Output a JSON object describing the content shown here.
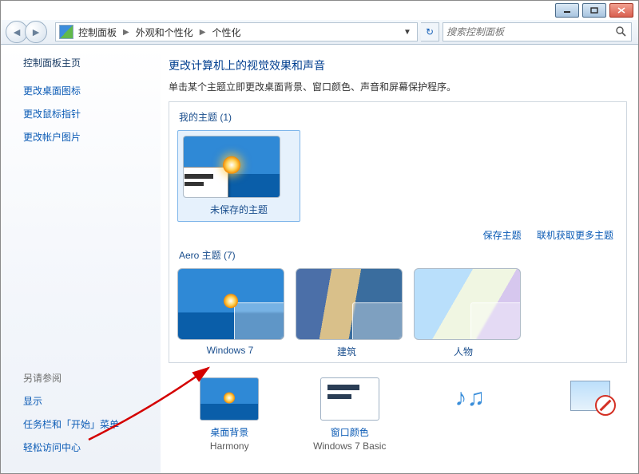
{
  "breadcrumb": {
    "root": "控制面板",
    "mid": "外观和个性化",
    "leaf": "个性化"
  },
  "search_placeholder": "搜索控制面板",
  "sidebar": {
    "home": "控制面板主页",
    "links": [
      "更改桌面图标",
      "更改鼠标指针",
      "更改帐户图片"
    ],
    "see_also_label": "另请参阅",
    "see_also": [
      "显示",
      "任务栏和「开始」菜单",
      "轻松访问中心"
    ]
  },
  "main": {
    "title": "更改计算机上的视觉效果和声音",
    "subtitle": "单击某个主题立即更改桌面背景、窗口颜色、声音和屏幕保护程序。",
    "my_themes_label": "我的主题 (1)",
    "unsaved_theme": "未保存的主题",
    "save_theme": "保存主题",
    "more_themes": "联机获取更多主题",
    "aero_label": "Aero 主题 (7)",
    "aero_caps": [
      "Windows 7",
      "建筑",
      "人物"
    ]
  },
  "options": {
    "bg": {
      "label": "桌面背景",
      "value": "Harmony"
    },
    "wc": {
      "label": "窗口颜色",
      "value": "Windows 7 Basic"
    },
    "snd": {
      "label": "",
      "value": ""
    },
    "scr": {
      "label": "",
      "value": ""
    }
  }
}
